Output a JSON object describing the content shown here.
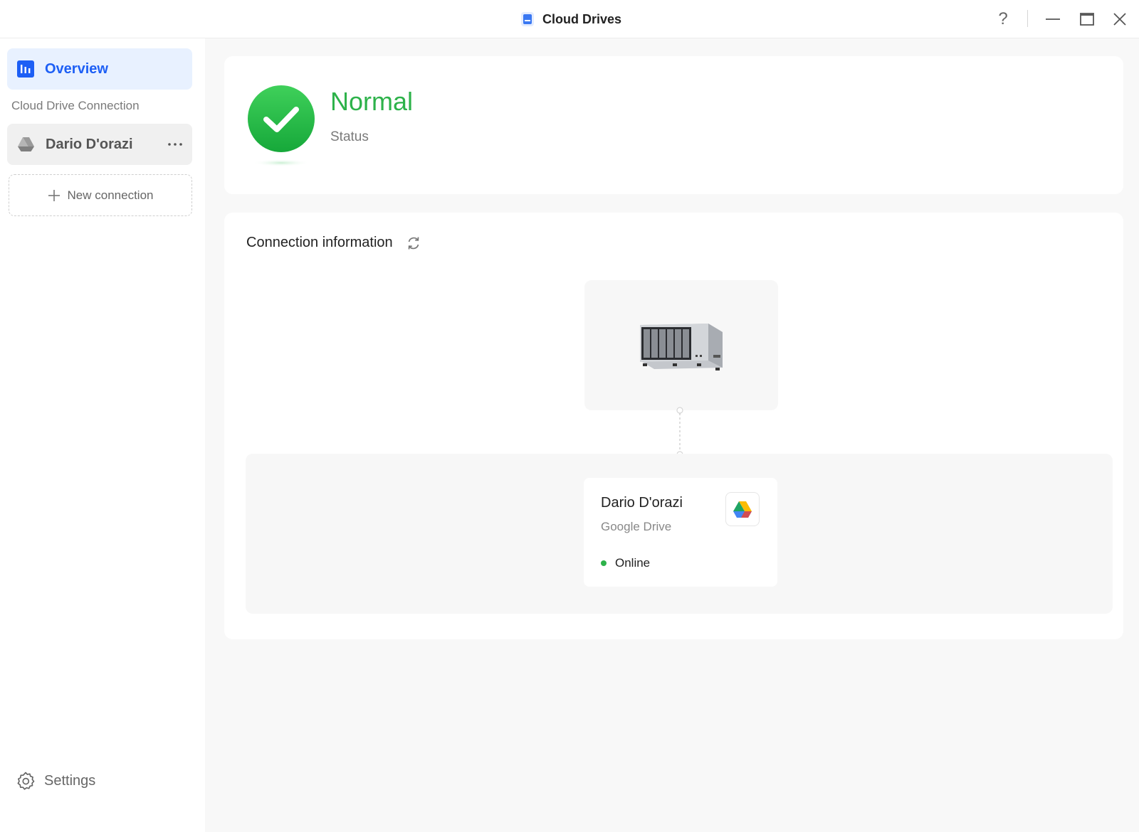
{
  "window": {
    "title": "Cloud Drives",
    "help_label": "?"
  },
  "sidebar": {
    "overview_label": "Overview",
    "section_label": "Cloud Drive Connection",
    "connections": [
      {
        "label": "Dario D'orazi",
        "more_label": "···"
      }
    ],
    "new_connection_label": "New connection",
    "settings_label": "Settings"
  },
  "status": {
    "title": "Normal",
    "subtitle": "Status"
  },
  "connection_info": {
    "title": "Connection information",
    "drive": {
      "name": "Dario D'orazi",
      "provider": "Google Drive",
      "status": "Online"
    }
  },
  "colors": {
    "accent": "#1d5ff5",
    "ok_green": "#2db24a",
    "selected_bg": "#e8f1ff"
  }
}
